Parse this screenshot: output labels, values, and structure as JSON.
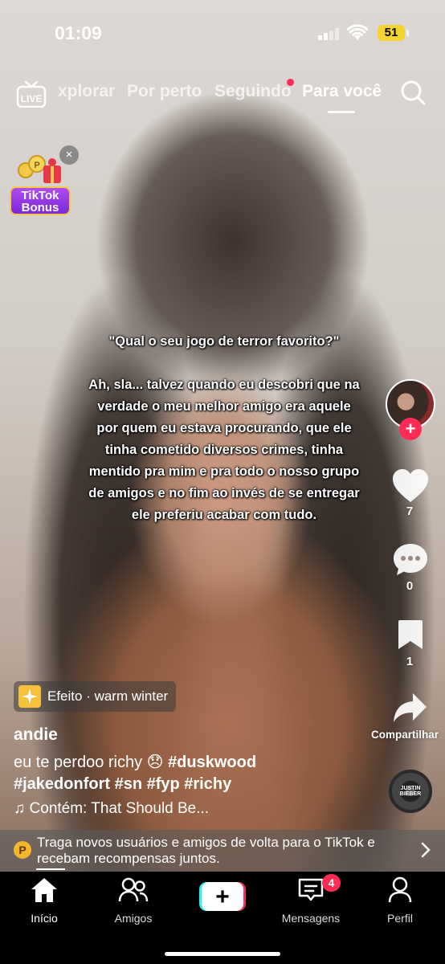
{
  "status_bar": {
    "time": "01:09",
    "battery": "51"
  },
  "top_nav": {
    "live_label": "LIVE",
    "tabs": [
      {
        "label": "xplorar"
      },
      {
        "label": "Por perto"
      },
      {
        "label": "Seguindo"
      },
      {
        "label": "Para você"
      }
    ],
    "active_tab": "Para você"
  },
  "bonus": {
    "label_line1": "TikTok",
    "label_line2": "Bonus",
    "close": "×"
  },
  "video_caption": {
    "question": "\"Qual o seu jogo de terror favorito?\"",
    "lines": [
      "Ah, sla... talvez quando eu descobri que na",
      "verdade o meu melhor amigo era aquele",
      "por quem eu estava procurando, que ele",
      "tinha cometido diversos crimes, tinha",
      "mentido pra mim e pra todo o nosso grupo",
      "de amigos e no fim ao invés de se entregar",
      "ele preferiu acabar com tudo."
    ]
  },
  "actions": {
    "likes": "7",
    "comments": "0",
    "saves": "1",
    "share_label": "Compartilhar",
    "follow": "+"
  },
  "effect": {
    "label": "Efeito · warm winter"
  },
  "post": {
    "username": "andie",
    "description_text": "eu te perdoo richy 😞 ",
    "tags_line1": "#duskwood",
    "tags_line2": "#jakedonfort #sn #fyp #richy",
    "music": "♫ Contém: That Should Be..."
  },
  "disc": {
    "text": "JUSTIN BIEBER"
  },
  "promo": {
    "icon": "P",
    "text": "Traga novos usuários e amigos de volta para o TikTok e recebam recompensas juntos."
  },
  "bottom_nav": {
    "items": [
      {
        "label": "Início"
      },
      {
        "label": "Amigos"
      },
      {
        "label": ""
      },
      {
        "label": "Mensagens"
      },
      {
        "label": "Perfil"
      }
    ],
    "messages_badge": "4",
    "plus": "+"
  },
  "colors": {
    "accent": "#fe2c55",
    "battery": "#f4d431",
    "promo_coin": "#f3b72b"
  }
}
